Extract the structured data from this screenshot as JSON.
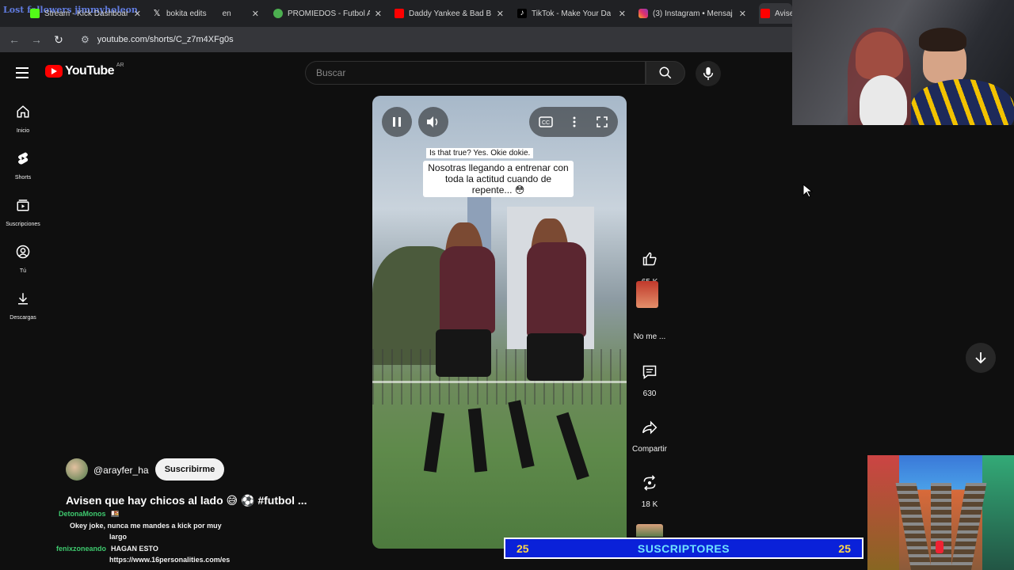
{
  "browser": {
    "tabs": [
      {
        "title": "Stream - Kick Dashboar",
        "color": "#53fc18"
      },
      {
        "title": "bokita edits",
        "color": "#ffffff"
      },
      {
        "title": "PROMIEDOS - Futbol A",
        "color": "#4caf50"
      },
      {
        "title": "Daddy Yankee & Bad B",
        "color": "#ff0000"
      },
      {
        "title": "TikTok - Make Your Da",
        "color": "#ffffff"
      },
      {
        "title": "(3) Instagram • Mensaj",
        "color": "#e1306c"
      },
      {
        "title": "Avise",
        "color": "#ff0000"
      }
    ],
    "kick_overlay": "Lost followers   jimmyholeon",
    "tab_fragment": "en",
    "url": "youtube.com/shorts/C_z7m4XFg0s"
  },
  "youtube": {
    "logo_text": "YouTube",
    "region": "AR",
    "search_placeholder": "Buscar",
    "sidebar": [
      {
        "label": "Inicio",
        "icon": "home-icon"
      },
      {
        "label": "Shorts",
        "icon": "shorts-icon"
      },
      {
        "label": "Suscripciones",
        "icon": "subscriptions-icon"
      },
      {
        "label": "Tú",
        "icon": "user-icon"
      },
      {
        "label": "Descargas",
        "icon": "download-icon"
      }
    ]
  },
  "short": {
    "caption_small": "Is that true? Yes. Okie dokie.",
    "caption_big": "Nosotras llegando a entrenar con toda la actitud cuando de repente... 😳",
    "channel": "@arayfer_ha",
    "subscribe_label": "Suscribirme",
    "title": "Avisen que hay chicos al lado 😅 ⚽ #futbol ...",
    "actions": {
      "likes": "65 K",
      "dislike_label": "No me ...",
      "comments": "630",
      "share_label": "Compartir",
      "remix": "18 K"
    }
  },
  "chat": [
    {
      "user": "DetonaMonos",
      "message": "🍱"
    },
    {
      "user": "",
      "message": "Okey joke, nunca me mandes a kick por muy"
    },
    {
      "user": "",
      "message": "largo"
    },
    {
      "user": "fenixzoneando",
      "message": "HAGAN ESTO"
    },
    {
      "user": "",
      "message": "https://www.16personalities.com/es"
    }
  ],
  "goal": {
    "left": "25",
    "label": "SUSCRIPTORES",
    "right": "25"
  }
}
